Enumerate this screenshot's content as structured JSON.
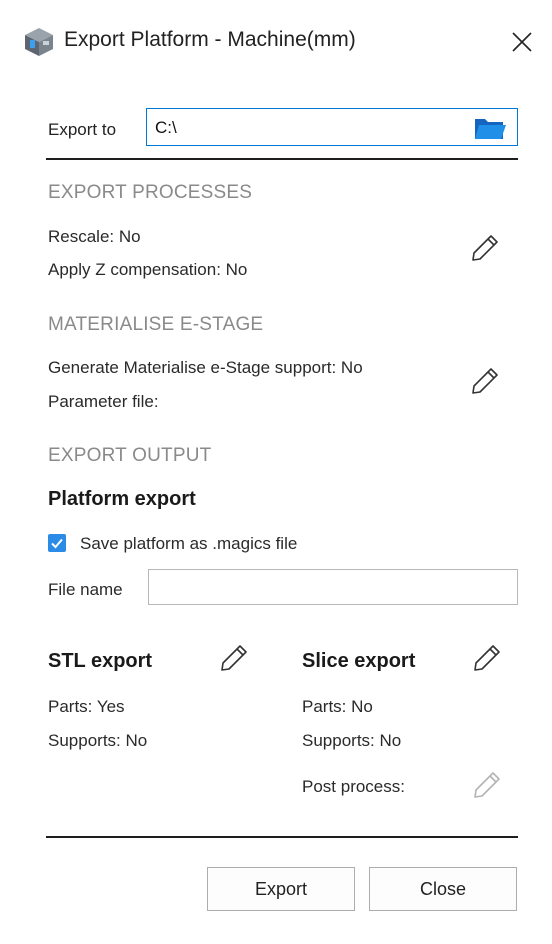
{
  "window": {
    "title": "Export Platform - Machine(mm)"
  },
  "export_to": {
    "label": "Export to",
    "path": "C:\\"
  },
  "export_processes": {
    "heading": "EXPORT PROCESSES",
    "rescale": "Rescale:  No",
    "z_comp": "Apply Z compensation:  No"
  },
  "estage": {
    "heading": "MATERIALISE E-STAGE",
    "generate": "Generate Materialise e-Stage support:  No",
    "param_file": "Parameter file:"
  },
  "export_output": {
    "heading": "EXPORT OUTPUT",
    "platform_export": "Platform export",
    "save_magics_label": "Save platform as .magics file",
    "save_magics_checked": true,
    "file_name_label": "File name",
    "file_name_value": ""
  },
  "stl_export": {
    "title": "STL export",
    "parts": "Parts:  Yes",
    "supports": "Supports:  No"
  },
  "slice_export": {
    "title": "Slice export",
    "parts": "Parts:  No",
    "supports": "Supports:  No",
    "post_process": "Post process:"
  },
  "buttons": {
    "export": "Export",
    "close": "Close"
  },
  "colors": {
    "accent": "#0078d7",
    "checkbox": "#2b8be6",
    "folder": "#1f8fe8",
    "section": "#8a8a8a"
  }
}
